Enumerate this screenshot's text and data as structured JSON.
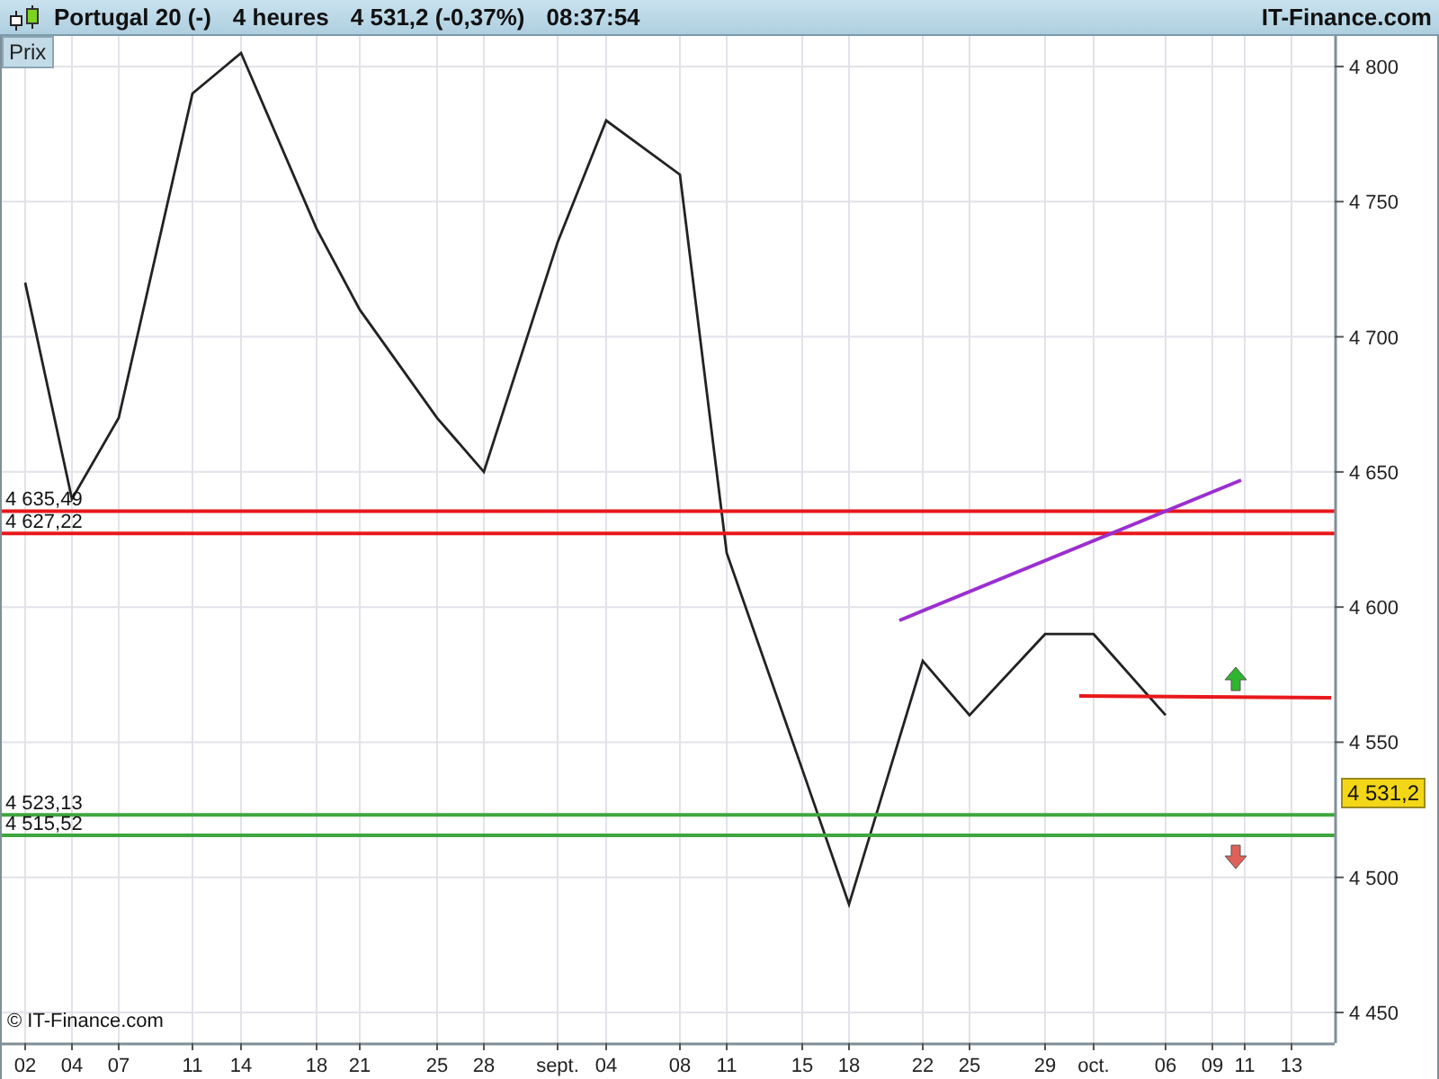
{
  "header": {
    "instrument": "Portugal 20 (-)",
    "period": "4 heures",
    "quote": "4 531,2 (-0,37%)",
    "time": "08:37:54",
    "brand": "IT-Finance.com"
  },
  "chart": {
    "axis_label": "Prix",
    "copyright": "© IT-Finance.com",
    "chart_data": {
      "type": "line",
      "grid": true,
      "ylim": [
        4438.7,
        4811.3
      ],
      "categories": [
        "02",
        "04",
        "07",
        "11",
        "14",
        "18",
        "21",
        "25",
        "28",
        "sept.",
        "04",
        "08",
        "11",
        "15",
        "18",
        "22",
        "25",
        "29",
        "oct.",
        "06",
        "09",
        "11",
        "13"
      ],
      "series": [
        {
          "color": "#222222",
          "values": [
            4720,
            4640,
            4670,
            4790,
            4805,
            4740,
            4710,
            4670,
            4650,
            4735,
            4780,
            4760,
            4620,
            4540,
            4490,
            4580,
            4560,
            4590,
            4590,
            4560,
            null,
            null,
            null
          ]
        }
      ],
      "yticks": [
        {
          "value": 4450,
          "label": "4 450"
        },
        {
          "value": 4500,
          "label": "4 500"
        },
        {
          "value": 4550,
          "label": "4 550"
        },
        {
          "value": 4600,
          "label": "4 600"
        },
        {
          "value": 4650,
          "label": "4 650"
        },
        {
          "value": 4700,
          "label": "4 700"
        },
        {
          "value": 4750,
          "label": "4 750"
        },
        {
          "value": 4800,
          "label": "4 800"
        }
      ],
      "ref_lines": [
        {
          "axis": "y",
          "value": 4635.49,
          "label": "4 635,49",
          "color": "#e8181c"
        },
        {
          "axis": "y",
          "value": 4627.22,
          "label": "4 627,22",
          "color": "#e8181c"
        },
        {
          "axis": "y",
          "value": 4523.13,
          "label": "4 523,13",
          "color": "#3fa63f"
        },
        {
          "axis": "y",
          "value": 4515.52,
          "label": "4 515,52",
          "color": "#3fa63f"
        }
      ]
    },
    "current_price": "4 531,2"
  }
}
